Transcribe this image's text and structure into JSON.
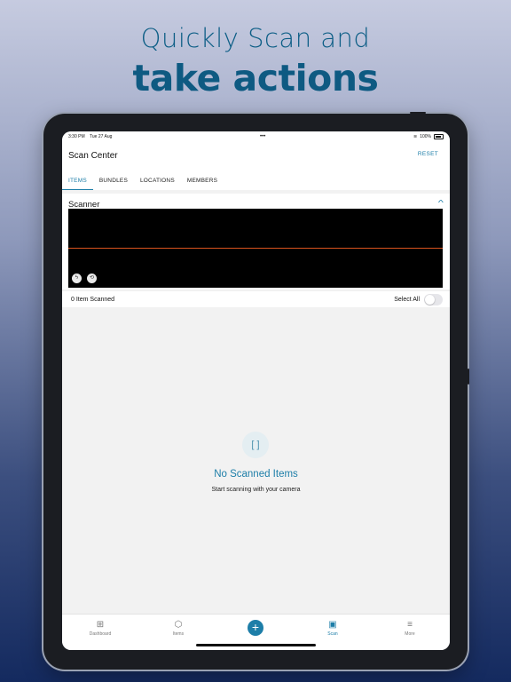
{
  "promo": {
    "line1": "Quickly Scan and",
    "line2": "take actions"
  },
  "status_bar": {
    "time": "3:30 PM",
    "date": "Tue 27 Aug",
    "dots": "•••",
    "wifi": "≋",
    "battery_text": "100%"
  },
  "header": {
    "title": "Scan Center",
    "reset_label": "RESET"
  },
  "tabs": [
    {
      "label": "ITEMS",
      "active": true
    },
    {
      "label": "BUNDLES",
      "active": false
    },
    {
      "label": "LOCATIONS",
      "active": false
    },
    {
      "label": "MEMBERS",
      "active": false
    }
  ],
  "scanner": {
    "label": "Scanner",
    "collapse_icon": "chevron-up-icon",
    "flash_icon": "ϟ",
    "flip_icon": "⟲",
    "laser_color": "#d9531e"
  },
  "scan_list": {
    "count_label": "0 Item Scanned",
    "select_all_label": "Select All",
    "select_all_on": false
  },
  "empty_state": {
    "icon": "scan-frame-icon",
    "icon_glyph": "[ ]",
    "title": "No Scanned Items",
    "subtitle": "Start scanning with your camera"
  },
  "nav": [
    {
      "label": "Dashboard",
      "icon": "⊞"
    },
    {
      "label": "Items",
      "icon": "⬡"
    },
    {
      "label": "",
      "icon": "+"
    },
    {
      "label": "Scan",
      "icon": "▣",
      "active": true
    },
    {
      "label": "More",
      "icon": "≡"
    }
  ],
  "colors": {
    "accent": "#1d7ea8",
    "headline": "#0e5a82"
  }
}
